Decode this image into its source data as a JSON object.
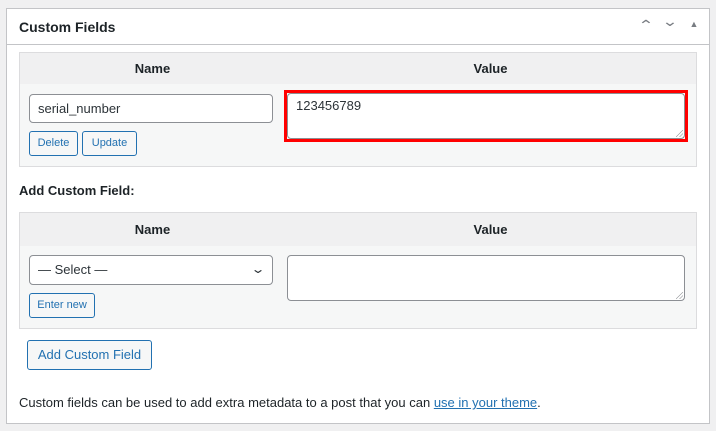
{
  "panel": {
    "title": "Custom Fields",
    "controls": {
      "up": "⌃",
      "down": "⌄",
      "toggle": "▲"
    }
  },
  "existing": {
    "name_header": "Name",
    "value_header": "Value",
    "name_value": "serial_number",
    "value_value": "123456789",
    "delete_label": "Delete",
    "update_label": "Update",
    "highlight_color": "#ff0000"
  },
  "add_section": {
    "label": "Add Custom Field:",
    "name_header": "Name",
    "value_header": "Value",
    "select_value": "— Select —",
    "enter_new_label": "Enter new",
    "value_value": "",
    "add_button_label": "Add Custom Field"
  },
  "footer": {
    "text": "Custom fields can be used to add extra metadata to a post that you can ",
    "link": "use in your theme",
    "suffix": "."
  }
}
